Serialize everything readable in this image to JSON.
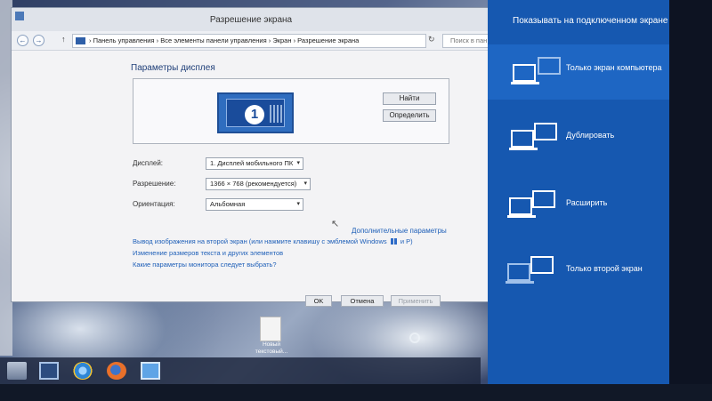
{
  "window": {
    "title": "Разрешение экрана",
    "breadcrumb": [
      "Панель управления",
      "Все элементы панели управления",
      "Экран",
      "Разрешение экрана"
    ],
    "search_placeholder": "Поиск в пан"
  },
  "display": {
    "heading": "Параметры дисплея",
    "monitor_number": "1",
    "identify_button": "Найти",
    "detect_button": "Определить",
    "display_label": "Дисплей:",
    "display_value": "1. Дисплей мобильного ПК",
    "resolution_label": "Разрешение:",
    "resolution_value": "1366 × 768 (рекомендуется)",
    "orientation_label": "Ориентация:",
    "orientation_value": "Альбомная",
    "advanced_link": "Дополнительные параметры",
    "link_project_text": "Вывод изображения на второй экран (или нажмите клавишу с эмблемой Windows",
    "link_project_suffix": "и P)",
    "link_text_size": "Изменение размеров текста и других элементов",
    "link_which_settings": "Какие параметры монитора следует выбрать?",
    "ok_button": "OK",
    "cancel_button": "Отмена",
    "apply_button": "Применить"
  },
  "desktop": {
    "file_label": "Новый текстовый..."
  },
  "charm": {
    "title": "Показывать на подключенном экране",
    "options": [
      {
        "label": "Только экран компьютера"
      },
      {
        "label": "Дублировать"
      },
      {
        "label": "Расширить"
      },
      {
        "label": "Только второй экран"
      }
    ]
  },
  "colors": {
    "charm_background": "#1658b0",
    "selected_option": "#1e66c3",
    "link": "#1e5fb8"
  }
}
